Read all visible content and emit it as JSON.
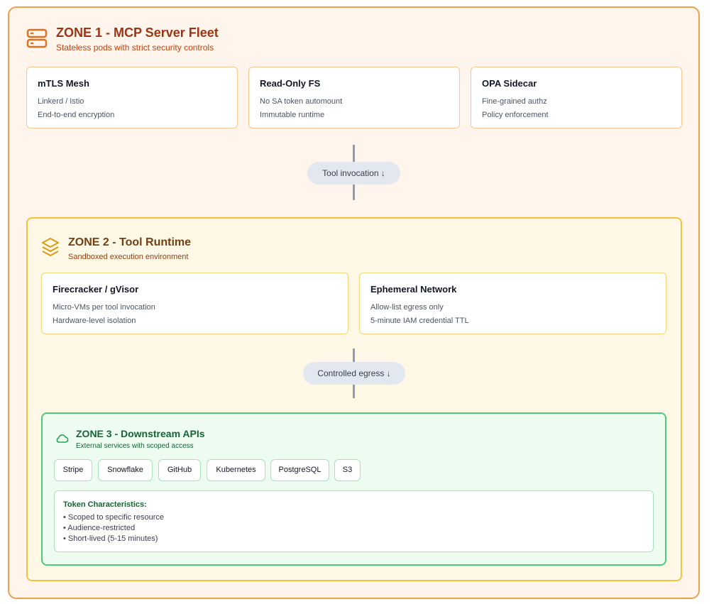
{
  "zone1": {
    "title": "ZONE 1 - MCP Server Fleet",
    "subtitle": "Stateless pods with strict security controls",
    "icon": "server-icon",
    "cards": [
      {
        "title": "mTLS Mesh",
        "lines": [
          "Linkerd / Istio",
          "End-to-end encryption"
        ]
      },
      {
        "title": "Read-Only FS",
        "lines": [
          "No SA token automount",
          "Immutable runtime"
        ]
      },
      {
        "title": "OPA Sidecar",
        "lines": [
          "Fine-grained authz",
          "Policy enforcement"
        ]
      }
    ]
  },
  "connectors": {
    "first": "Tool invocation ↓",
    "second": "Controlled egress ↓"
  },
  "zone2": {
    "title": "ZONE 2 - Tool Runtime",
    "subtitle": "Sandboxed execution environment",
    "icon": "layers-icon",
    "cards": [
      {
        "title": "Firecracker / gVisor",
        "lines": [
          "Micro-VMs per tool invocation",
          "Hardware-level isolation"
        ]
      },
      {
        "title": "Ephemeral Network",
        "lines": [
          "Allow-list egress only",
          "5-minute IAM credential TTL"
        ]
      }
    ]
  },
  "zone3": {
    "title": "ZONE 3 - Downstream APIs",
    "subtitle": "External services with scoped access",
    "icon": "cloud-icon",
    "chips": [
      "Stripe",
      "Snowflake",
      "GitHub",
      "Kubernetes",
      "PostgreSQL",
      "S3"
    ],
    "token": {
      "title": "Token Characteristics:",
      "items": [
        "• Scoped to specific resource",
        "• Audience-restricted",
        "• Short-lived (5-15 minutes)"
      ]
    }
  },
  "colors": {
    "zone1_border": "#f0a04b",
    "zone1_bg": "#fff5ec",
    "zone2_border": "#f4c33d",
    "zone2_bg": "#fff8e6",
    "zone3_border": "#4ccb7a",
    "zone3_bg": "#eefbf1",
    "connector": "#8e9bb0",
    "pill_bg": "#e3e8f0"
  }
}
